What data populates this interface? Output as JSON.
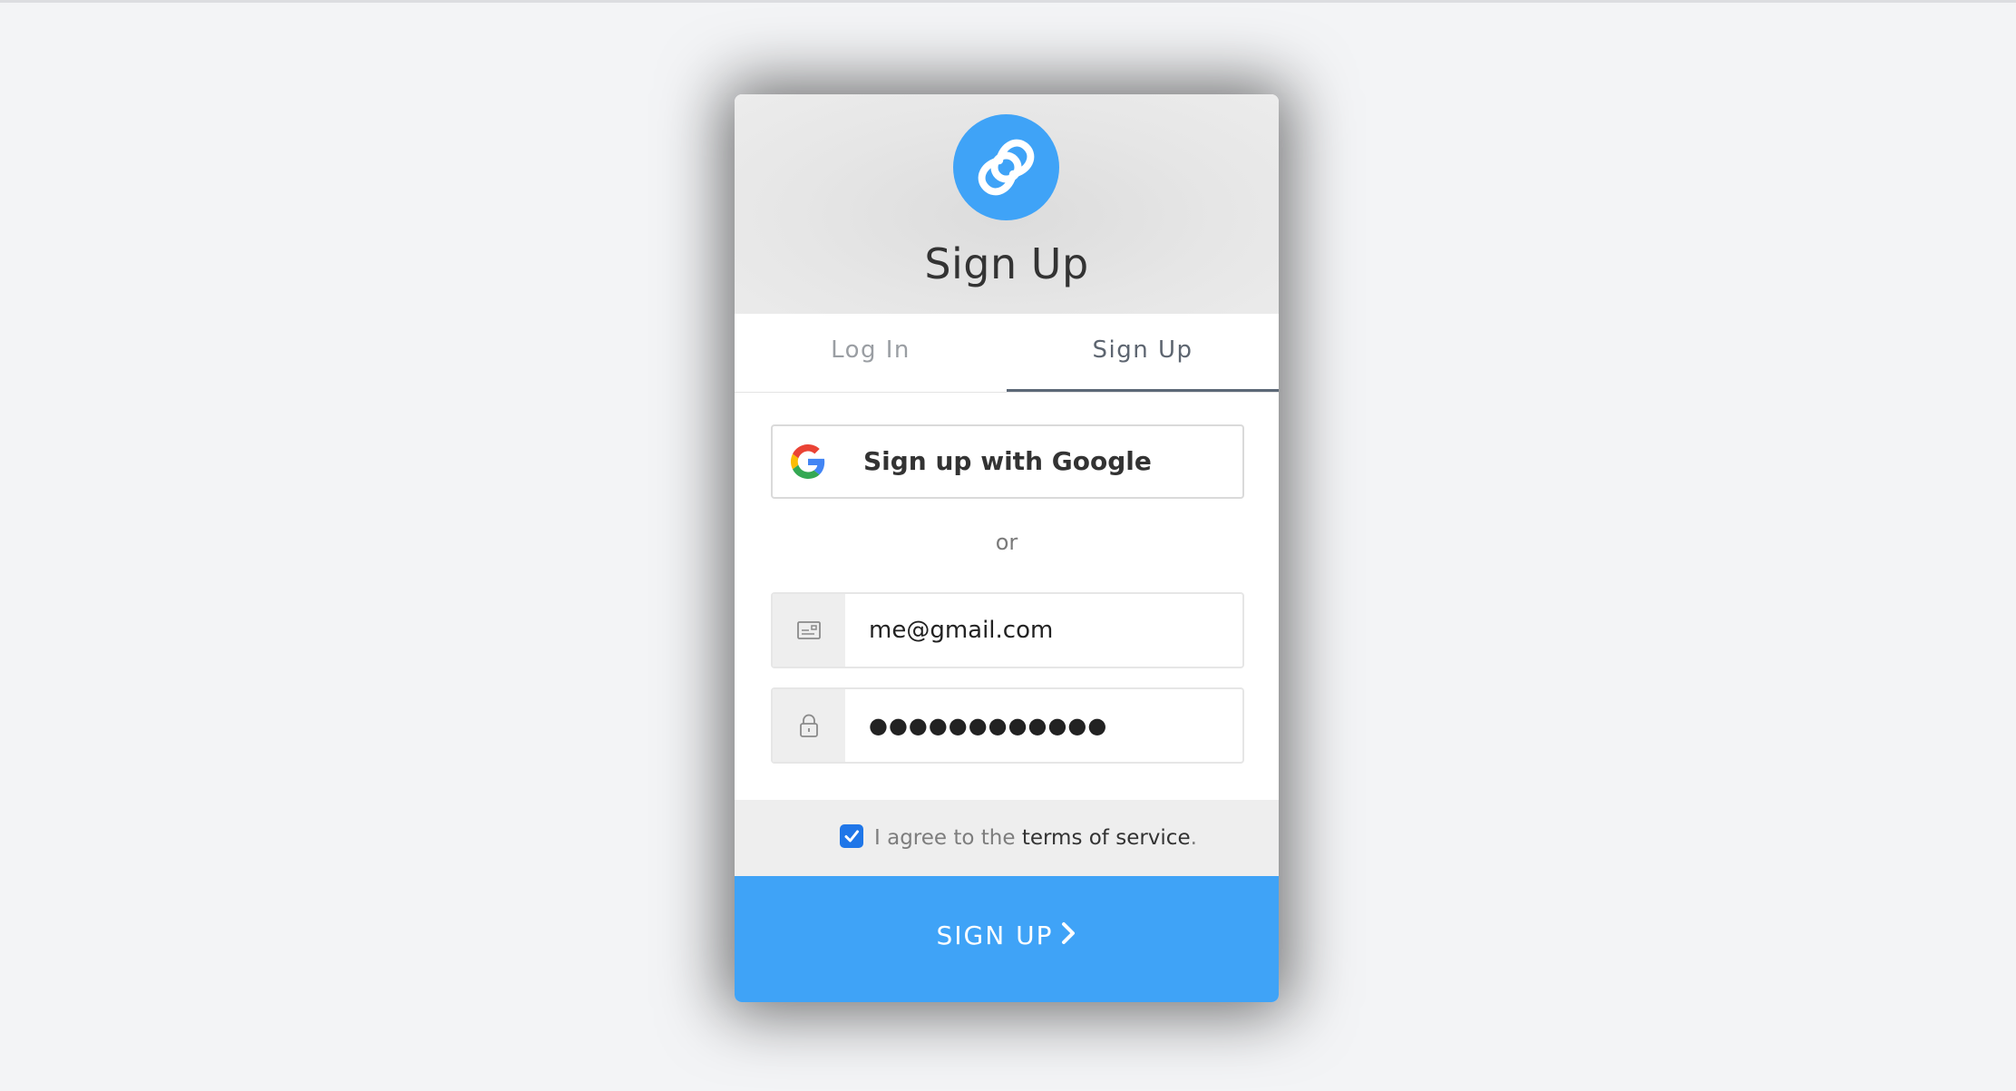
{
  "header": {
    "title": "Sign Up",
    "logo_icon": "helium-logo-icon",
    "logo_color": "#3fa3f7"
  },
  "tabs": [
    {
      "label": "Log In",
      "active": false
    },
    {
      "label": "Sign Up",
      "active": true
    }
  ],
  "google_button": {
    "label": "Sign up with Google",
    "icon": "google-icon"
  },
  "separator": "or",
  "email_field": {
    "icon": "email-card-icon",
    "value": "me@gmail.com"
  },
  "password_field": {
    "icon": "lock-icon",
    "value": "●●●●●●●●●●●●"
  },
  "terms": {
    "checked": true,
    "text": "I agree to the",
    "link": "terms of service",
    "suffix": "."
  },
  "submit": {
    "label": "SIGN UP",
    "icon": "chevron-right-icon",
    "color": "#3fa3f7"
  }
}
